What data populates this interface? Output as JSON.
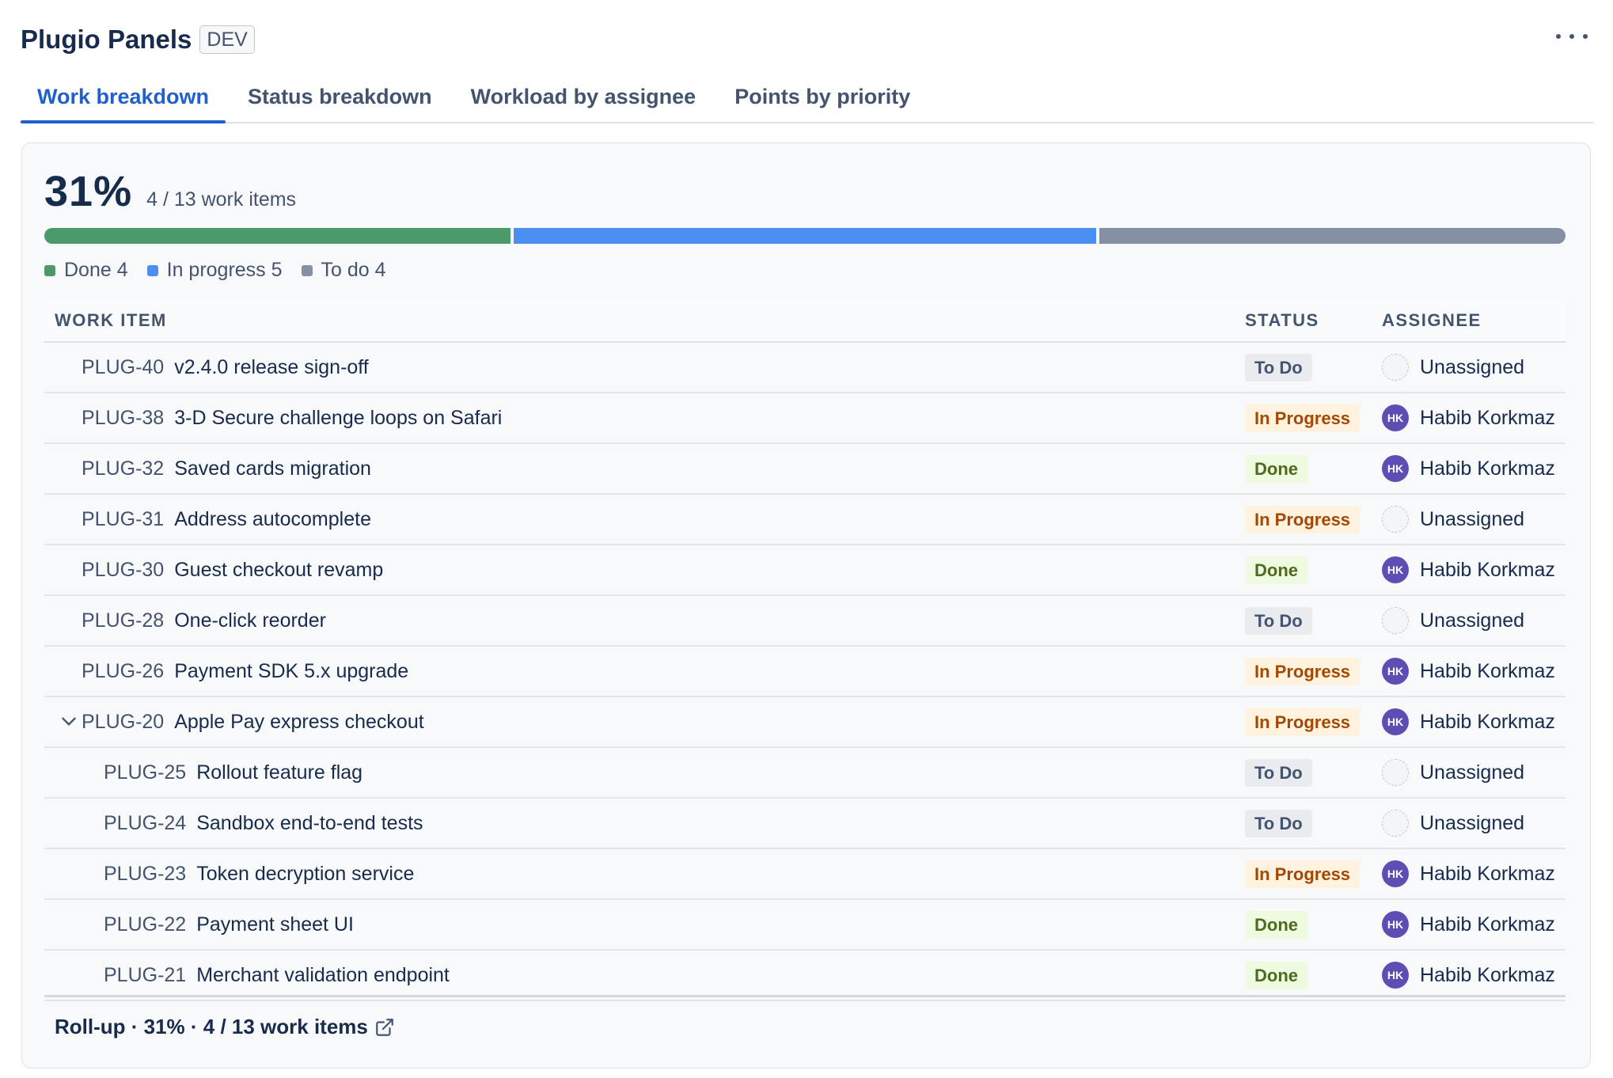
{
  "header": {
    "title": "Plugio Panels",
    "env_badge": "DEV"
  },
  "tabs": [
    {
      "label": "Work breakdown",
      "active": true
    },
    {
      "label": "Status breakdown",
      "active": false
    },
    {
      "label": "Workload by assignee",
      "active": false
    },
    {
      "label": "Points by priority",
      "active": false
    }
  ],
  "summary": {
    "percent": "31%",
    "count_text": "4 / 13 work items"
  },
  "progress": {
    "segments": [
      {
        "key": "done",
        "value": 4,
        "color": "#4c9a6a"
      },
      {
        "key": "in_progress",
        "value": 5,
        "color": "#4c8ff3"
      },
      {
        "key": "todo",
        "value": 4,
        "color": "#8590a2"
      }
    ]
  },
  "legend": [
    {
      "label": "Done 4",
      "color": "#4c9a6a"
    },
    {
      "label": "In progress 5",
      "color": "#4c8ff3"
    },
    {
      "label": "To do 4",
      "color": "#8590a2"
    }
  ],
  "table": {
    "columns": {
      "item": "WORK ITEM",
      "status": "STATUS",
      "assignee": "ASSIGNEE"
    },
    "rows": [
      {
        "key": "PLUG-40",
        "summary": "v2.4.0 release sign-off",
        "status": "To Do",
        "assignee": "Unassigned",
        "initials": "",
        "level": 0,
        "expandable": false
      },
      {
        "key": "PLUG-38",
        "summary": "3-D Secure challenge loops on Safari",
        "status": "In Progress",
        "assignee": "Habib Korkmaz",
        "initials": "HK",
        "level": 0,
        "expandable": false
      },
      {
        "key": "PLUG-32",
        "summary": "Saved cards migration",
        "status": "Done",
        "assignee": "Habib Korkmaz",
        "initials": "HK",
        "level": 0,
        "expandable": false
      },
      {
        "key": "PLUG-31",
        "summary": "Address autocomplete",
        "status": "In Progress",
        "assignee": "Unassigned",
        "initials": "",
        "level": 0,
        "expandable": false
      },
      {
        "key": "PLUG-30",
        "summary": "Guest checkout revamp",
        "status": "Done",
        "assignee": "Habib Korkmaz",
        "initials": "HK",
        "level": 0,
        "expandable": false
      },
      {
        "key": "PLUG-28",
        "summary": "One-click reorder",
        "status": "To Do",
        "assignee": "Unassigned",
        "initials": "",
        "level": 0,
        "expandable": false
      },
      {
        "key": "PLUG-26",
        "summary": "Payment SDK 5.x upgrade",
        "status": "In Progress",
        "assignee": "Habib Korkmaz",
        "initials": "HK",
        "level": 0,
        "expandable": false
      },
      {
        "key": "PLUG-20",
        "summary": "Apple Pay express checkout",
        "status": "In Progress",
        "assignee": "Habib Korkmaz",
        "initials": "HK",
        "level": 0,
        "expandable": true
      },
      {
        "key": "PLUG-25",
        "summary": "Rollout feature flag",
        "status": "To Do",
        "assignee": "Unassigned",
        "initials": "",
        "level": 1,
        "expandable": false
      },
      {
        "key": "PLUG-24",
        "summary": "Sandbox end-to-end tests",
        "status": "To Do",
        "assignee": "Unassigned",
        "initials": "",
        "level": 1,
        "expandable": false
      },
      {
        "key": "PLUG-23",
        "summary": "Token decryption service",
        "status": "In Progress",
        "assignee": "Habib Korkmaz",
        "initials": "HK",
        "level": 1,
        "expandable": false
      },
      {
        "key": "PLUG-22",
        "summary": "Payment sheet UI",
        "status": "Done",
        "assignee": "Habib Korkmaz",
        "initials": "HK",
        "level": 1,
        "expandable": false
      },
      {
        "key": "PLUG-21",
        "summary": "Merchant validation endpoint",
        "status": "Done",
        "assignee": "Habib Korkmaz",
        "initials": "HK",
        "level": 1,
        "expandable": false
      }
    ]
  },
  "status_styles": {
    "To Do": {
      "bg": "#e9ebee",
      "fg": "#44546f"
    },
    "In Progress": {
      "bg": "#fff3e0",
      "fg": "#a54800"
    },
    "Done": {
      "bg": "#effbe1",
      "fg": "#4c6b1f"
    }
  },
  "rollup": {
    "text": "Roll-up · 31% · 4 / 13 work items"
  }
}
